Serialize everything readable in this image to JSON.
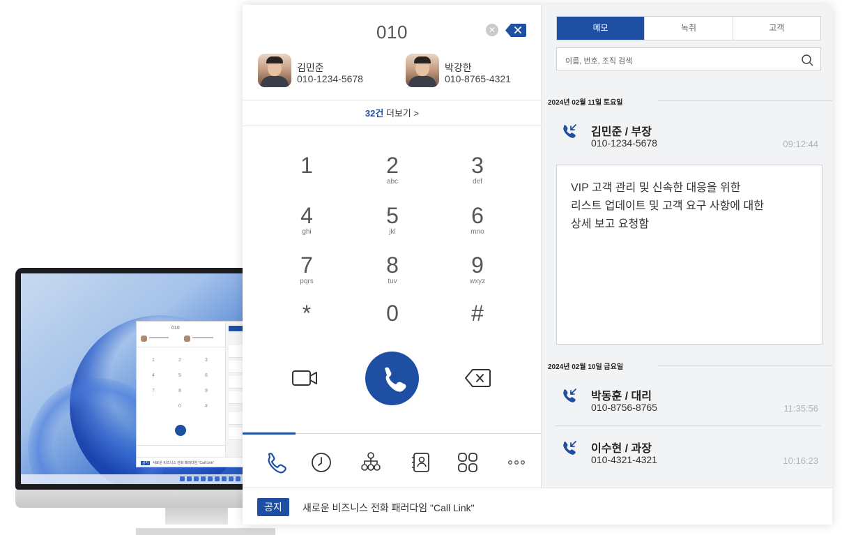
{
  "dialer": {
    "number": "010",
    "contacts": [
      {
        "name": "김민준",
        "phone": "010-1234-5678"
      },
      {
        "name": "박강한",
        "phone": "010-8765-4321"
      }
    ],
    "more_count": "32건",
    "more_label": "더보기 >",
    "keys": [
      {
        "digit": "1",
        "letters": ""
      },
      {
        "digit": "2",
        "letters": "abc"
      },
      {
        "digit": "3",
        "letters": "def"
      },
      {
        "digit": "4",
        "letters": "ghi"
      },
      {
        "digit": "5",
        "letters": "jkl"
      },
      {
        "digit": "6",
        "letters": "mno"
      },
      {
        "digit": "7",
        "letters": "pqrs"
      },
      {
        "digit": "8",
        "letters": "tuv"
      },
      {
        "digit": "9",
        "letters": "wxyz"
      },
      {
        "digit": "*",
        "letters": ""
      },
      {
        "digit": "0",
        "letters": ""
      },
      {
        "digit": "#",
        "letters": ""
      }
    ]
  },
  "nav": {
    "items": [
      "phone-icon",
      "clock-icon",
      "org-chart-icon",
      "contacts-book-icon",
      "apps-grid-icon",
      "more-dots-icon"
    ],
    "more_glyph": "ooo"
  },
  "panel": {
    "tabs": [
      "메모",
      "녹취",
      "고객"
    ],
    "active_tab": "메모",
    "search_placeholder": "이름, 번호, 조직 검색",
    "groups": [
      {
        "date": "2024년 02월 11일 토요일",
        "logs": [
          {
            "name": "김민준 / 부장",
            "phone": "010-1234-5678",
            "time": "09:12:44"
          }
        ]
      },
      {
        "date": "2024년 02월 10일 금요일",
        "logs": [
          {
            "name": "박동훈 / 대리",
            "phone": "010-8756-8765",
            "time": "11:35:56"
          },
          {
            "name": "이수현 / 과장",
            "phone": "010-4321-4321",
            "time": "10:16:23"
          }
        ]
      }
    ],
    "memo_lines": [
      "VIP 고객 관리 및 신속한 대응을 위한",
      "리스트 업데이트 및 고객 요구 사항에 대한",
      "상세 보고 요청함"
    ]
  },
  "notice": {
    "badge": "공지",
    "text": "새로운 비즈니스 전화 패러다임 \"Call Link\""
  },
  "colors": {
    "accent": "#1e4fa3",
    "panel_bg": "#f2f3f5",
    "muted_time": "#b0b3b8"
  }
}
